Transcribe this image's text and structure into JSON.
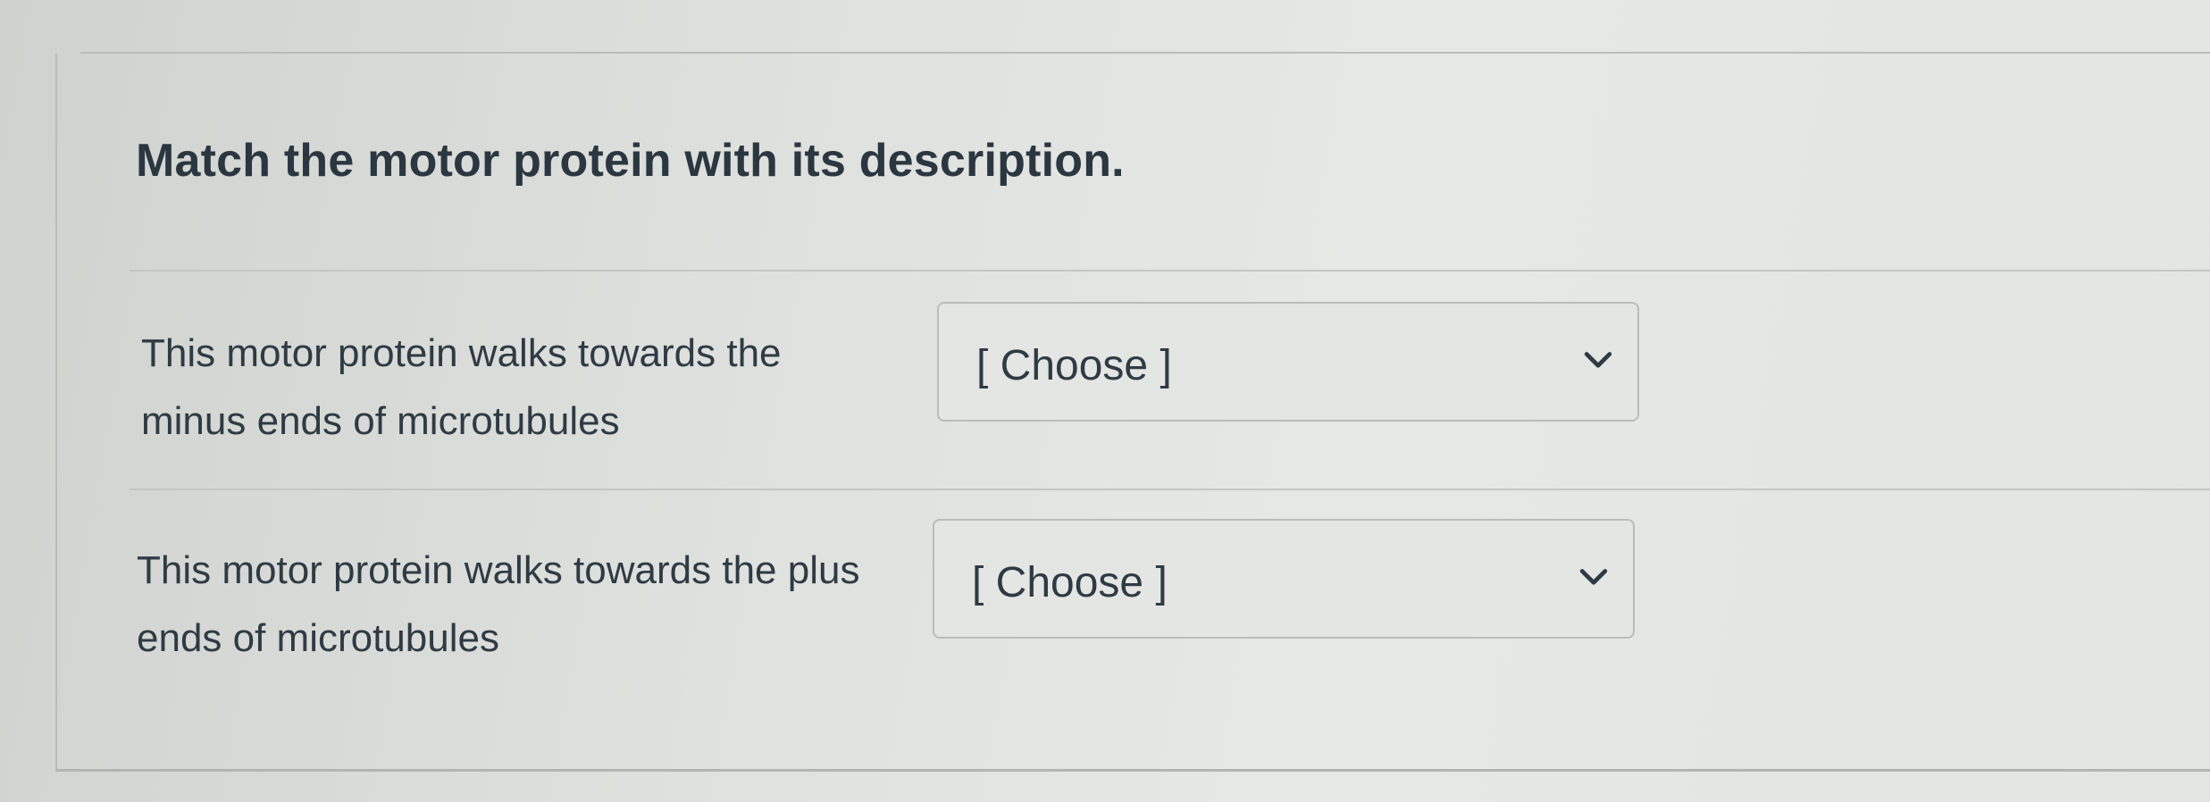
{
  "question": {
    "title": "Match the motor protein with its description."
  },
  "rows": [
    {
      "prompt_lines": [
        "This motor protein walks towards the",
        "minus ends of microtubules"
      ],
      "select": {
        "value": "[ Choose ]",
        "icon": "chevron-down-icon"
      }
    },
    {
      "prompt_lines": [
        "This motor protein walks towards the plus",
        "ends of microtubules"
      ],
      "select": {
        "value": "[ Choose ]",
        "icon": "chevron-down-icon"
      }
    }
  ],
  "colors": {
    "background": "#d9dbd8",
    "text": "#2d3b45",
    "border": "#b9bdba"
  }
}
